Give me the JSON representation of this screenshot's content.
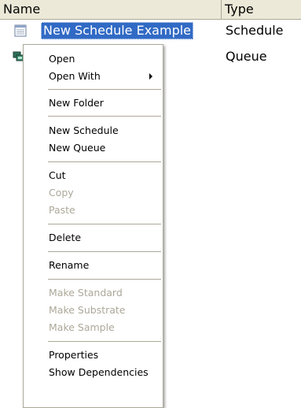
{
  "columns": {
    "name": "Name",
    "type": "Type"
  },
  "rows": [
    {
      "name": "New Schedule Example",
      "type": "Schedule",
      "icon": "schedule-icon",
      "selected": true
    },
    {
      "name": "",
      "type": "Queue",
      "icon": "queue-icon",
      "selected": false
    }
  ],
  "context_menu": {
    "open": "Open",
    "open_with": "Open With",
    "new_folder": "New Folder",
    "new_schedule": "New Schedule",
    "new_queue": "New Queue",
    "cut": "Cut",
    "copy": "Copy",
    "paste": "Paste",
    "delete": "Delete",
    "rename": "Rename",
    "make_standard": "Make Standard",
    "make_substrate": "Make Substrate",
    "make_sample": "Make Sample",
    "properties": "Properties",
    "show_dependencies": "Show Dependencies"
  },
  "colors": {
    "selection": "#316ac5",
    "header_bg": "#ece9d8",
    "disabled_text": "#aca899"
  }
}
